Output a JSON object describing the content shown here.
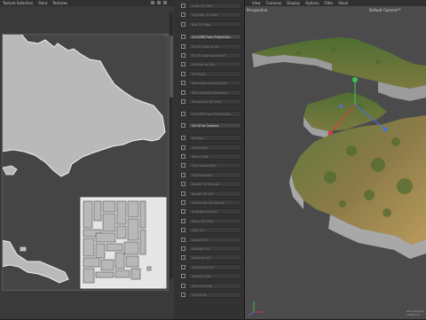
{
  "uv_editor": {
    "menu": [
      "Texture Selection",
      "Paint",
      "Textures"
    ],
    "corner_top": "1 1",
    "corner_bottom": "1.0"
  },
  "commands": {
    "items": [
      {
        "label": "Cube UV Map",
        "bright": false
      },
      {
        "label": "Cylinder UV Map",
        "bright": false
      },
      {
        "label": "Box UV Map",
        "bright": false
      },
      {
        "label": "UV-IVRM From Projection...",
        "bright": true
      },
      {
        "label": "Fit UV View to Sel",
        "bright": false
      },
      {
        "label": "Fit UV View and Relax",
        "bright": false
      },
      {
        "label": "Fit View to UVs",
        "bright": false
      },
      {
        "label": "UV Relax",
        "bright": false
      },
      {
        "label": "Normalize Island Scale",
        "bright": false
      },
      {
        "label": "Pack Islands Geometric",
        "bright": false
      },
      {
        "label": "Straighten UV Strip",
        "bright": false
      },
      {
        "label": "UV-IVRM From Projection...",
        "bright": false
      },
      {
        "label": "UV IVI to Camera",
        "bright": true
      },
      {
        "label": "Realign",
        "bright": false
      },
      {
        "label": "Normalize",
        "bright": false
      },
      {
        "label": "Match Size",
        "bright": false
      },
      {
        "label": "Flip Horizontally",
        "bright": false
      },
      {
        "label": "Flip Vertically",
        "bright": false
      },
      {
        "label": "Rotate UV Islands",
        "bright": false
      },
      {
        "label": "Rotate 90 CW",
        "bright": false
      },
      {
        "label": "Distribute UV Islands",
        "bright": false
      },
      {
        "label": "Arrange UV Grid",
        "bright": false
      },
      {
        "label": "Relax UV Pins",
        "bright": false
      },
      {
        "label": "Grid UV",
        "bright": false
      },
      {
        "label": "Layout UV",
        "bright": false
      },
      {
        "label": "Straight UV",
        "bright": false
      },
      {
        "label": "Quantize UV",
        "bright": false
      },
      {
        "label": "Symmetry UV",
        "bright": false
      },
      {
        "label": "Transfer UVs",
        "bright": false
      },
      {
        "label": "Texel Density",
        "bright": false
      },
      {
        "label": "Check UV",
        "bright": false
      }
    ]
  },
  "viewport": {
    "menu": [
      "View",
      "Cameras",
      "Display",
      "Options",
      "Filter",
      "Panel"
    ],
    "label_left": "Perspective",
    "label_right": "Default Camera**",
    "footer": "Grid Spacing: 10000 cm"
  },
  "colors": {
    "panel": "#3a3a3a",
    "viewport": "#4b4b4b",
    "uv_shape": "#b8b8b8",
    "uv_outline": "#efefef"
  }
}
